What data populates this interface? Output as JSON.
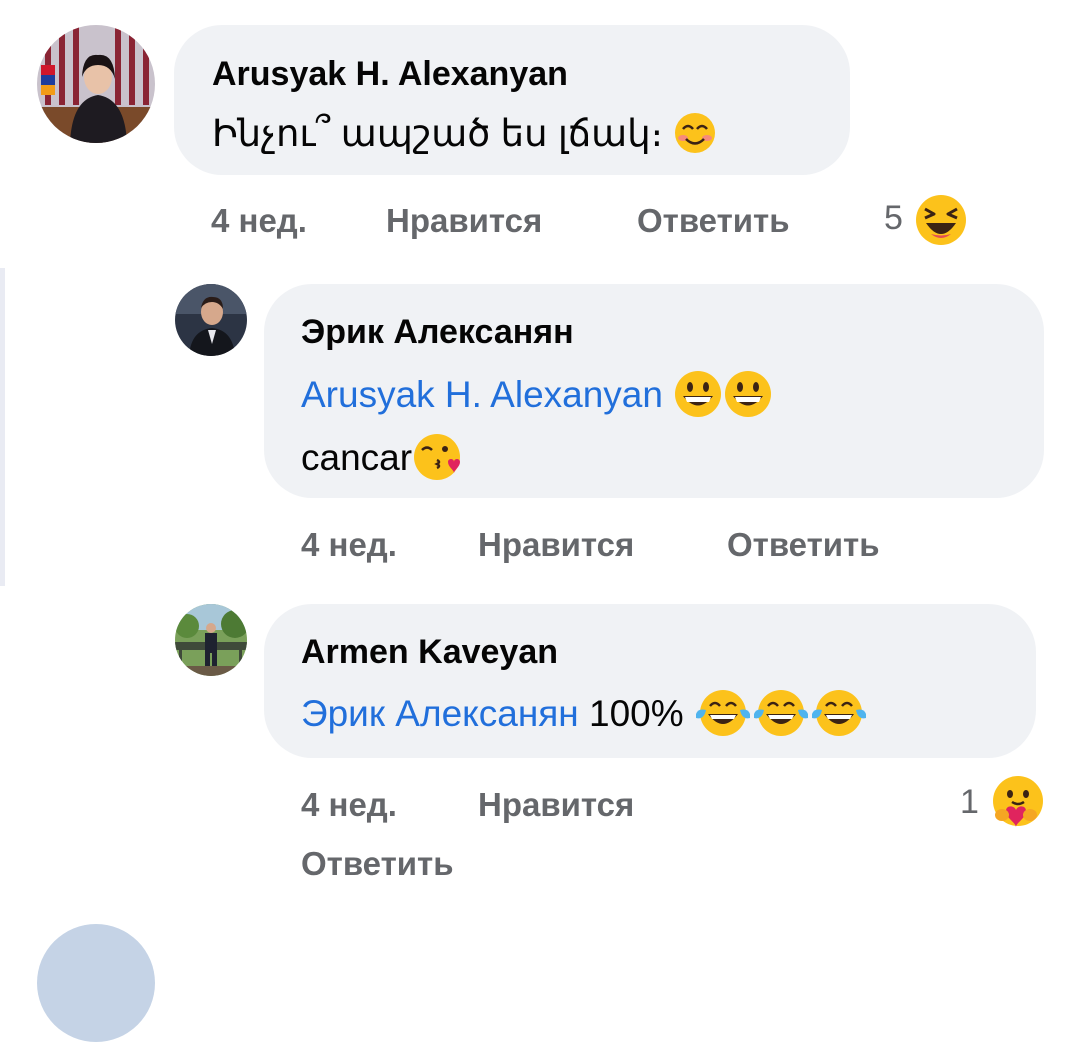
{
  "comments": [
    {
      "author": "Arusyak H. Alexanyan",
      "text": "Ինչու՞ ապշած ես լճակ։",
      "time": "4 нед.",
      "like_label": "Нравится",
      "reply_label": "Ответить",
      "reaction_count": "5",
      "reaction_icon": "laughing-face-icon"
    },
    {
      "author": "Эрик Алексанян",
      "mention": "Arusyak H. Alexanyan",
      "text_line2": "cancar",
      "time": "4 нед.",
      "like_label": "Нравится",
      "reply_label": "Ответить"
    },
    {
      "author": "Armen Kaveyan",
      "mention": "Эрик Алексанян",
      "text": "100%",
      "time": "4 нед.",
      "like_label": "Нравится",
      "reply_label": "Ответить",
      "reaction_count": "1",
      "reaction_icon": "care-face-icon"
    }
  ],
  "colors": {
    "bubble": "#f0f2f5",
    "mention": "#216fdb",
    "meta_text": "#65676b",
    "author_text": "#050505"
  }
}
